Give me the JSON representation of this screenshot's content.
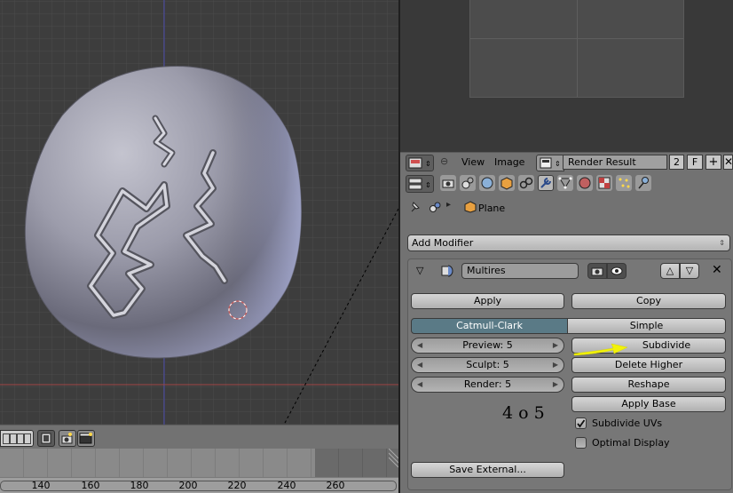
{
  "timeline": {
    "frames": [
      "140",
      "160",
      "180",
      "200",
      "220",
      "240",
      "260"
    ]
  },
  "image_editor": {
    "menu": {
      "view": "View",
      "image": "Image"
    },
    "image_name": "Render Result",
    "slot": "2",
    "fake_user": "F"
  },
  "properties": {
    "context_object": "Plane",
    "add_modifier": "Add Modifier",
    "modifier": {
      "name": "Multires",
      "apply": "Apply",
      "copy": "Copy",
      "subdivision_types": [
        "Catmull-Clark",
        "Simple"
      ],
      "active_type": "Catmull-Clark",
      "preview": "Preview: 5",
      "sculpt": "Sculpt: 5",
      "render": "Render: 5",
      "subdivide": "Subdivide",
      "delete_higher": "Delete Higher",
      "reshape": "Reshape",
      "apply_base": "Apply Base",
      "subdivide_uvs": {
        "label": "Subdivide UVs",
        "checked": true
      },
      "optimal_display": {
        "label": "Optimal Display",
        "checked": false
      },
      "save_external": "Save External..."
    }
  },
  "annotation": {
    "note": "4 o 5",
    "arrow_color": "#f2f20a"
  },
  "colors": {
    "viewport_bg": "#3d3d3d",
    "panel_bg": "#727272",
    "active_toggle": "#5a7a86",
    "x_axis": "#a04545",
    "z_axis": "#4848a8"
  }
}
